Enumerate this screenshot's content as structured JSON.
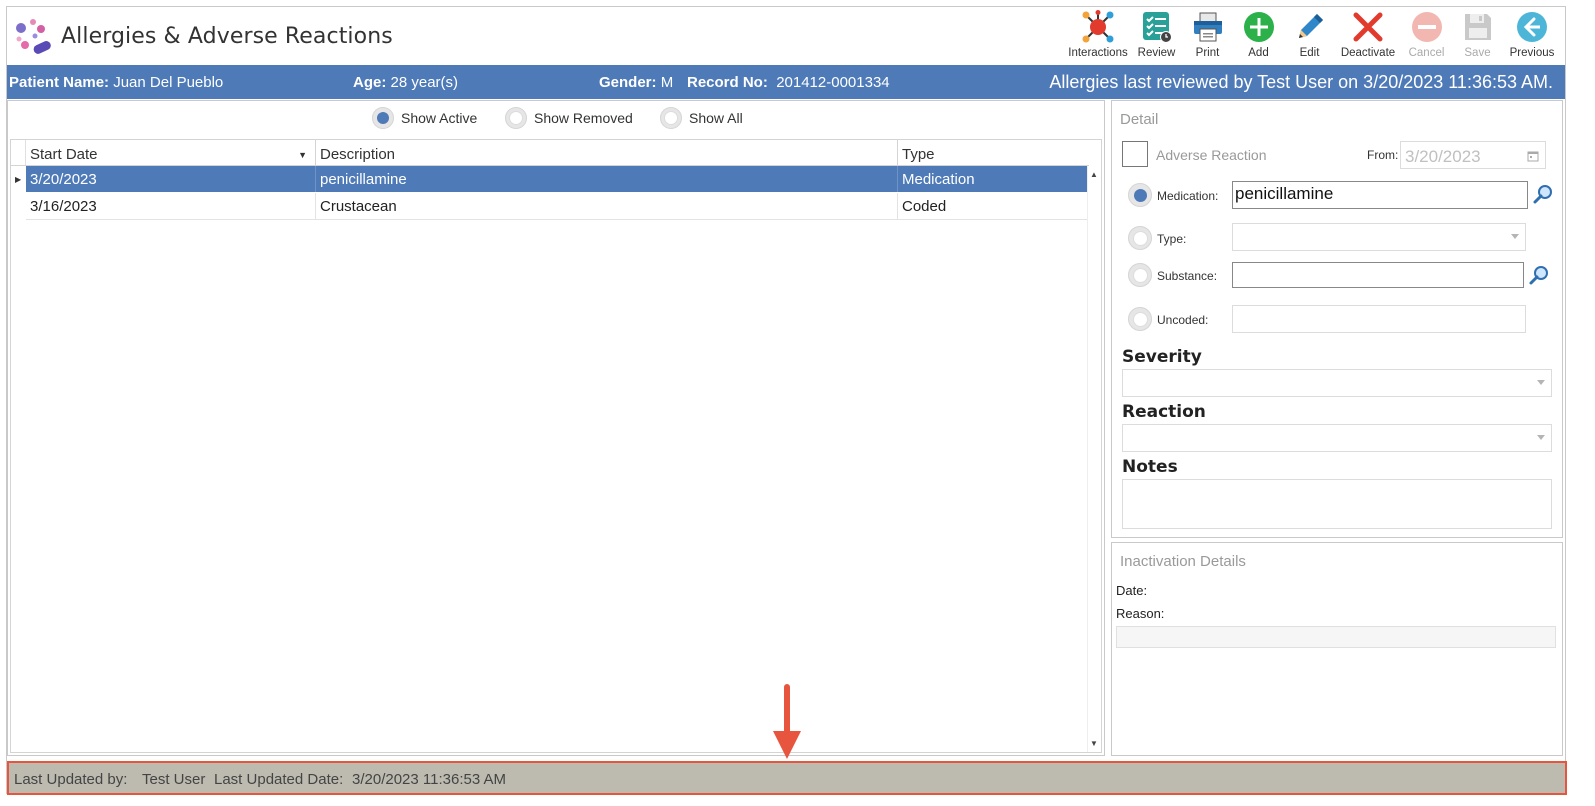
{
  "app": {
    "title": "Allergies & Adverse Reactions"
  },
  "toolbar": [
    {
      "label": "Interactions",
      "icon": "interactions-icon",
      "enabled": true
    },
    {
      "label": "Review",
      "icon": "review-checklist-icon",
      "enabled": true
    },
    {
      "label": "Print",
      "icon": "printer-icon",
      "enabled": true
    },
    {
      "label": "Add",
      "icon": "add-icon",
      "enabled": true
    },
    {
      "label": "Edit",
      "icon": "pencil-icon",
      "enabled": true
    },
    {
      "label": "Deactivate",
      "icon": "red-x-icon",
      "enabled": true
    },
    {
      "label": "Cancel",
      "icon": "cancel-icon",
      "enabled": false
    },
    {
      "label": "Save",
      "icon": "floppy-icon",
      "enabled": false
    },
    {
      "label": "Previous",
      "icon": "back-arrow-icon",
      "enabled": true
    }
  ],
  "patient": {
    "name_label": "Patient Name:",
    "name": "Juan Del Pueblo",
    "age_label": "Age:",
    "age": "28 year(s)",
    "gender_label": "Gender:",
    "gender": "M",
    "record_label": "Record No:",
    "record": "201412-0001334",
    "reviewed": "Allergies last reviewed by Test User on 3/20/2023 11:36:53 AM."
  },
  "filters": {
    "options": [
      "Show Active",
      "Show Removed",
      "Show All"
    ],
    "selected": "Show Active"
  },
  "grid": {
    "columns": [
      "Start Date",
      "Description",
      "Type"
    ],
    "rows": [
      {
        "start_date": "3/20/2023",
        "description": "penicillamine",
        "type": "Medication",
        "selected": true
      },
      {
        "start_date": "3/16/2023",
        "description": "Crustacean",
        "type": "Coded",
        "selected": false
      }
    ]
  },
  "detail": {
    "title": "Detail",
    "adverse_reaction_label": "Adverse Reaction",
    "from_label": "From:",
    "from_value": "3/20/2023",
    "medication_label": "Medication:",
    "medication_value": "penicillamine",
    "type_label": "Type:",
    "substance_label": "Substance:",
    "uncoded_label": "Uncoded:",
    "severity_label": "Severity",
    "reaction_label": "Reaction",
    "notes_label": "Notes",
    "selected_source": "Medication"
  },
  "inactivation": {
    "title": "Inactivation Details",
    "date_label": "Date:",
    "reason_label": "Reason:"
  },
  "status": {
    "updated_by_label": "Last Updated by:",
    "updated_by": "Test User",
    "updated_date_label": "Last Updated Date:",
    "updated_date": "3/20/2023 11:36:53 AM"
  },
  "colors": {
    "accent": "#4e7ab8",
    "status_bar": "#bdbbb0",
    "callout": "#e8553f"
  }
}
